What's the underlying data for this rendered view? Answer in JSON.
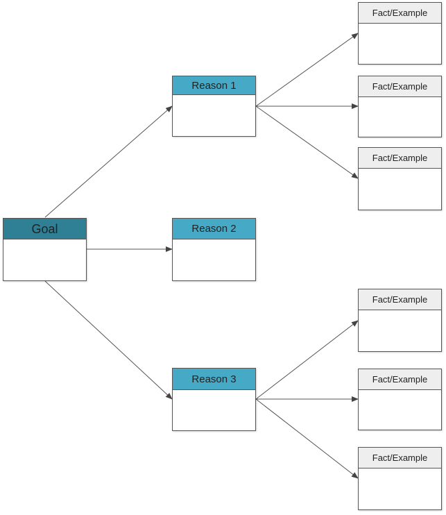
{
  "diagram": {
    "type": "tree",
    "nodes": [
      {
        "id": "goal",
        "label": "Goal",
        "kind": "goal"
      },
      {
        "id": "reason1",
        "label": "Reason 1",
        "kind": "reason"
      },
      {
        "id": "reason2",
        "label": "Reason 2",
        "kind": "reason"
      },
      {
        "id": "reason3",
        "label": "Reason 3",
        "kind": "reason"
      },
      {
        "id": "fact1",
        "label": "Fact/Example",
        "kind": "fact"
      },
      {
        "id": "fact2",
        "label": "Fact/Example",
        "kind": "fact"
      },
      {
        "id": "fact3",
        "label": "Fact/Example",
        "kind": "fact"
      },
      {
        "id": "fact4",
        "label": "Fact/Example",
        "kind": "fact"
      },
      {
        "id": "fact5",
        "label": "Fact/Example",
        "kind": "fact"
      },
      {
        "id": "fact6",
        "label": "Fact/Example",
        "kind": "fact"
      }
    ],
    "edges": [
      {
        "from": "goal",
        "to": "reason1"
      },
      {
        "from": "goal",
        "to": "reason2"
      },
      {
        "from": "goal",
        "to": "reason3"
      },
      {
        "from": "reason1",
        "to": "fact1"
      },
      {
        "from": "reason1",
        "to": "fact2"
      },
      {
        "from": "reason1",
        "to": "fact3"
      },
      {
        "from": "reason3",
        "to": "fact4"
      },
      {
        "from": "reason3",
        "to": "fact5"
      },
      {
        "from": "reason3",
        "to": "fact6"
      }
    ],
    "colors": {
      "goal_header": "#2f7f95",
      "reason_header": "#46a9c5",
      "fact_header": "#eeeeee",
      "line": "#555555"
    }
  }
}
